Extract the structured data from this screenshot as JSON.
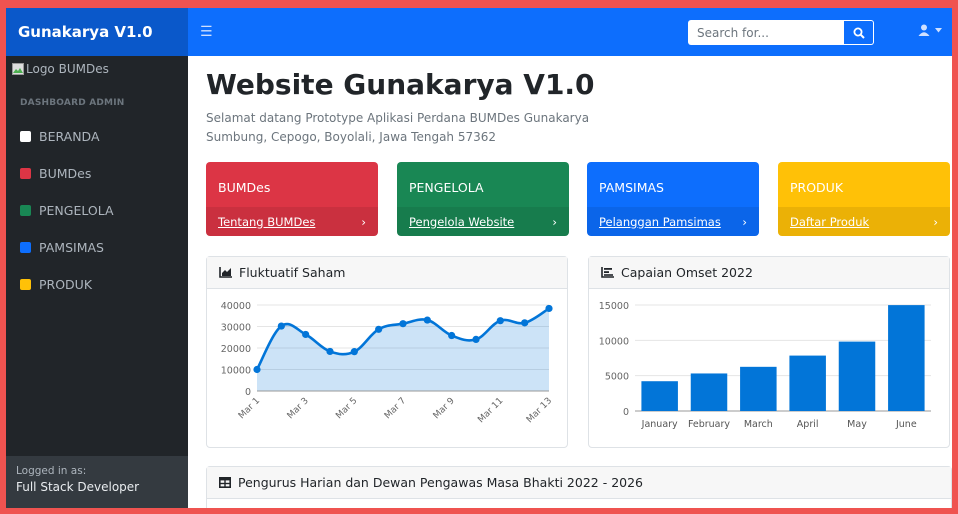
{
  "navbar": {
    "brand": "Gunakarya V1.0",
    "search_placeholder": "Search for..."
  },
  "sidebar": {
    "logo_alt": "Logo BUMDes",
    "heading": "DASHBOARD ADMIN",
    "items": [
      {
        "label": "BERANDA",
        "color": "#ffffff"
      },
      {
        "label": "BUMDes",
        "color": "#dc3545"
      },
      {
        "label": "PENGELOLA",
        "color": "#198754"
      },
      {
        "label": "PAMSIMAS",
        "color": "#0d6efd"
      },
      {
        "label": "PRODUK",
        "color": "#ffc107"
      }
    ],
    "footer_small": "Logged in as:",
    "footer_name": "Full Stack Developer"
  },
  "main": {
    "title": "Website Gunakarya V1.0",
    "subtitle_line1": "Selamat datang Prototype Aplikasi Perdana BUMDes Gunakarya",
    "subtitle_line2": "Sumbung, Cepogo, Boyolali, Jawa Tengah 57362",
    "cards": [
      {
        "title": "BUMDes",
        "link": "Tentang BUMDes",
        "color": "#dc3545"
      },
      {
        "title": "PENGELOLA",
        "link": "Pengelola Website",
        "color": "#198754"
      },
      {
        "title": "PAMSIMAS",
        "link": "Pelanggan Pamsimas",
        "color": "#0d6efd"
      },
      {
        "title": "PRODUK",
        "link": "Daftar Produk",
        "color": "#ffc107"
      }
    ],
    "area_panel_title": "Fluktuatif Saham",
    "bar_panel_title": "Capaian Omset 2022",
    "table_panel_title": "Pengurus Harian dan Dewan Pengawas Masa Bhakti 2022 - 2026"
  },
  "chart_data": [
    {
      "type": "area",
      "x": [
        "Mar 1",
        "Mar 2",
        "Mar 3",
        "Mar 4",
        "Mar 5",
        "Mar 6",
        "Mar 7",
        "Mar 8",
        "Mar 9",
        "Mar 10",
        "Mar 11",
        "Mar 12",
        "Mar 13"
      ],
      "tick_labels": [
        "Mar 1",
        "Mar 3",
        "Mar 5",
        "Mar 7",
        "Mar 9",
        "Mar 11",
        "Mar 13"
      ],
      "values": [
        10000,
        30200,
        26300,
        18400,
        18300,
        28700,
        31300,
        33000,
        25800,
        24000,
        32700,
        31700,
        38400
      ],
      "yticks": [
        "40000",
        "30000",
        "20000",
        "10000",
        "0"
      ],
      "ylim": [
        0,
        40000
      ],
      "color": "#0275d8",
      "fill": "rgba(2,117,216,0.2)"
    },
    {
      "type": "bar",
      "categories": [
        "January",
        "February",
        "March",
        "April",
        "May",
        "June"
      ],
      "values": [
        4215,
        5312,
        6251,
        7841,
        9821,
        14984
      ],
      "yticks": [
        "15000",
        "10000",
        "5000",
        "0"
      ],
      "ylim": [
        0,
        15000
      ],
      "color": "#0275d8"
    }
  ]
}
